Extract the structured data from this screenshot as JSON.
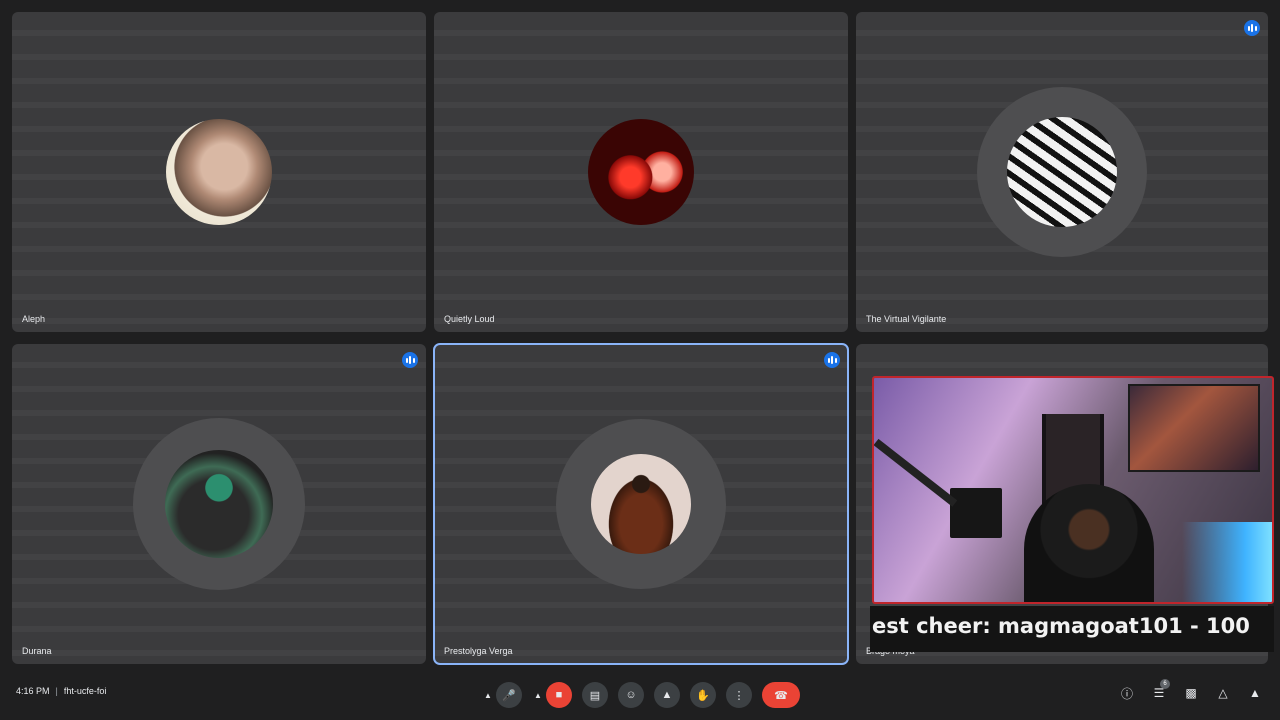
{
  "participants": [
    {
      "name": "Aleph",
      "speaking": false
    },
    {
      "name": "Quietly Loud",
      "speaking": false
    },
    {
      "name": "The Virtual Vigilante",
      "speaking": true
    },
    {
      "name": "Durana",
      "speaking": true
    },
    {
      "name": "Prestolyga Verga",
      "speaking": true,
      "active": true
    },
    {
      "name": "Brago moya",
      "speaking": false
    }
  ],
  "overlay": {
    "cheer_text": "est cheer: magmagoat101 - 100"
  },
  "bottom_bar": {
    "time": "4:16 PM",
    "separator": "|",
    "meeting_code": "fht-ucfe-foi",
    "participants_badge": "6"
  },
  "colors": {
    "active_outline": "#8ab4f8",
    "speaking": "#1a73e8",
    "danger": "#ea4335"
  },
  "icons": [
    "microphone-icon",
    "camera-off-icon",
    "captions-icon",
    "emoji-icon",
    "present-icon",
    "raise-hand-icon",
    "more-options-icon",
    "end-call-icon",
    "info-icon",
    "people-icon",
    "chat-icon",
    "activities-icon",
    "host-controls-icon"
  ]
}
